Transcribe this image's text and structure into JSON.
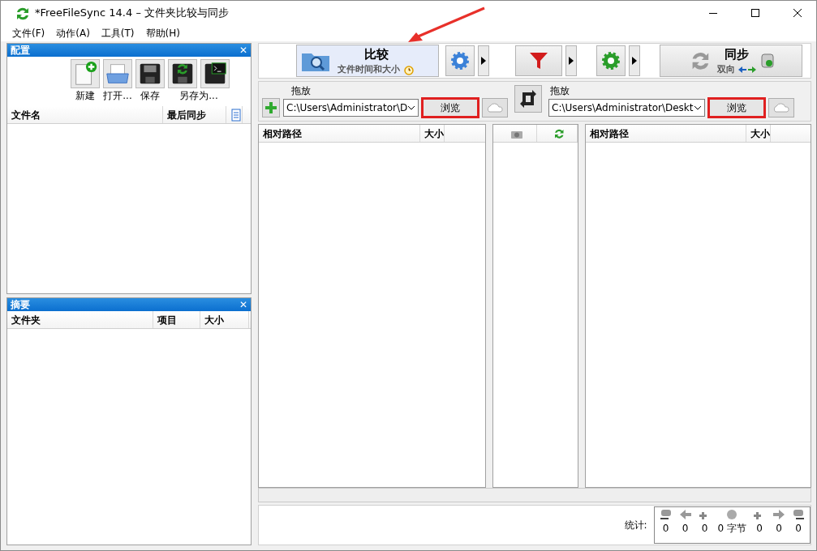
{
  "window": {
    "title": "*FreeFileSync 14.4 – 文件夹比较与同步"
  },
  "menu": [
    {
      "label": "文件(F)"
    },
    {
      "label": "动作(A)"
    },
    {
      "label": "工具(T)"
    },
    {
      "label": "帮助(H)"
    }
  ],
  "config_panel": {
    "title": "配置",
    "close": "✕",
    "tools": [
      {
        "kind": "new",
        "label": "新建"
      },
      {
        "kind": "open",
        "label": "打开..."
      },
      {
        "kind": "save",
        "label": "保存"
      },
      {
        "kind": "save-as",
        "label": "另存为..."
      }
    ],
    "columns": [
      "文件名",
      "最后同步"
    ]
  },
  "summary_panel": {
    "title": "摘要",
    "close": "✕",
    "columns": [
      "文件夹",
      "项目",
      "大小"
    ]
  },
  "toolbar": {
    "compare": {
      "label": "比较",
      "subtitle": "文件时间和大小"
    },
    "sync": {
      "label": "同步",
      "subtitle": "双向"
    }
  },
  "folders": [
    {
      "caption": "拖放",
      "path": "C:\\Users\\Administrator\\D",
      "browse": "浏览",
      "highlighted": true
    },
    {
      "caption": "拖放",
      "path": "C:\\Users\\Administrator\\Deskt",
      "browse": "浏览",
      "highlighted": true
    }
  ],
  "grid": {
    "left_columns": [
      "相对路径",
      "大小"
    ],
    "right_columns": [
      "相对路径",
      "大小"
    ]
  },
  "stats": {
    "label": "统计:",
    "counts": [
      "0",
      "0",
      "0",
      "0 字节",
      "0",
      "0",
      "0"
    ]
  },
  "annotation": {
    "kind": "arrow"
  }
}
